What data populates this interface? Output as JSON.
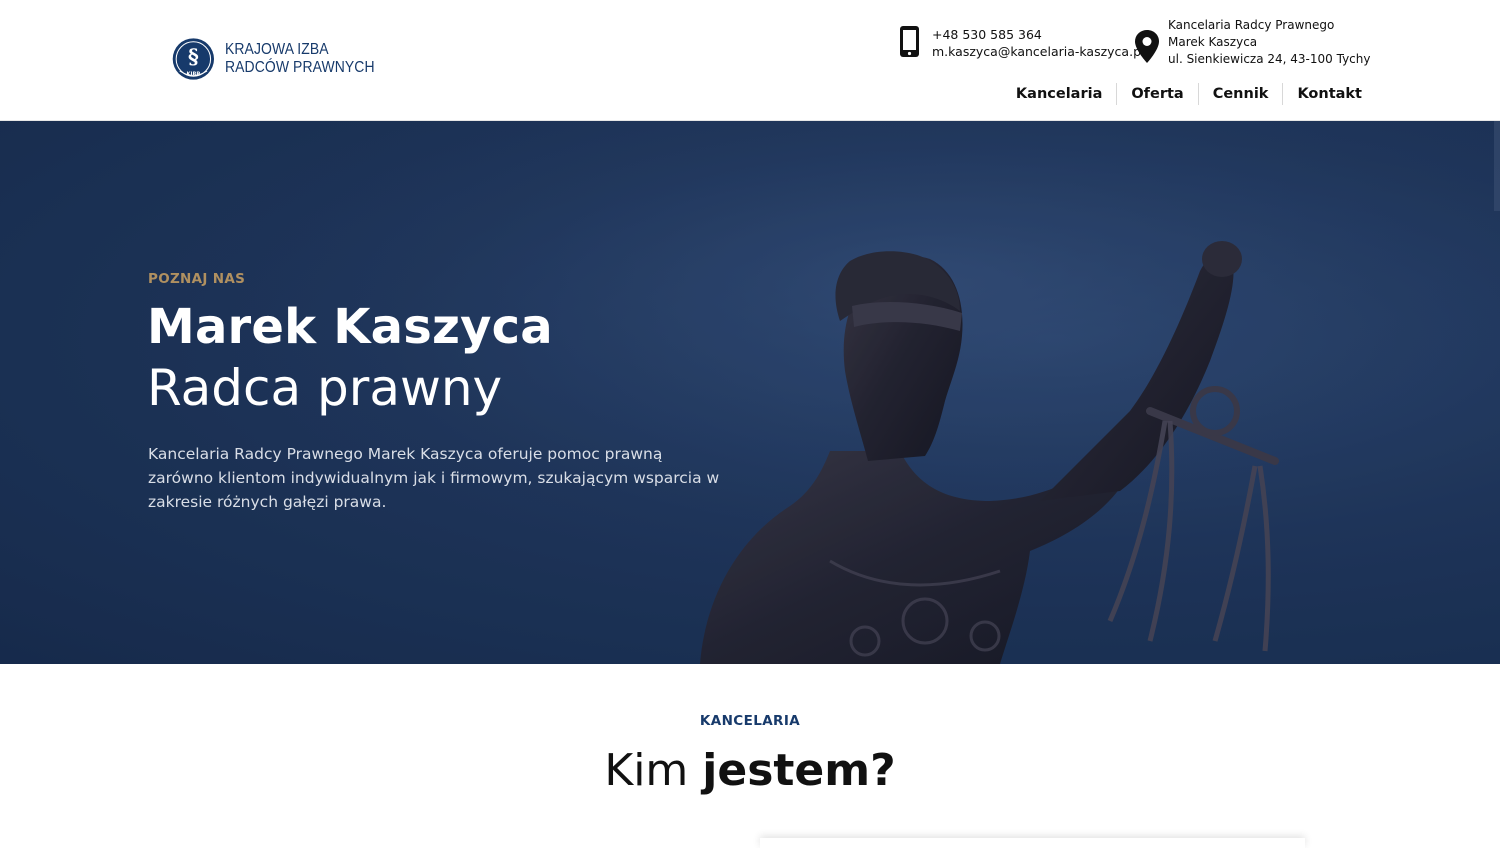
{
  "header": {
    "logo": {
      "line1": "KRAJOWA IZBA",
      "line2": "RADCÓW PRAWNYCH",
      "emblem_text": "KIRP",
      "icon": "section-sign-emblem"
    },
    "phone": {
      "icon": "smartphone-icon",
      "number": "+48 530 585 364",
      "email": "m.kaszyca@kancelaria-kaszyca.pl"
    },
    "address": {
      "icon": "map-pin-icon",
      "line1": "Kancelaria Radcy Prawnego",
      "line2": "Marek Kaszyca",
      "line3": "ul. Sienkiewicza 24, 43-100 Tychy"
    },
    "nav": [
      "Kancelaria",
      "Oferta",
      "Cennik",
      "Kontakt"
    ]
  },
  "hero": {
    "eyebrow": "POZNAJ NAS",
    "name": "Marek Kaszyca",
    "role": "Radca prawny",
    "description": "Kancelaria Radcy Prawnego Marek Kaszyca oferuje pomoc prawną zarówno klientom indywidualnym jak i firmowym, szukającym wsparcia w zakresie różnych gałęzi prawa."
  },
  "section": {
    "eyebrow": "KANCELARIA",
    "title_light": "Kim ",
    "title_bold": "jestem?"
  },
  "colors": {
    "brand_navy": "#173a6b",
    "hero_bg": "#1e3559",
    "eyebrow_gold": "#b09060"
  }
}
